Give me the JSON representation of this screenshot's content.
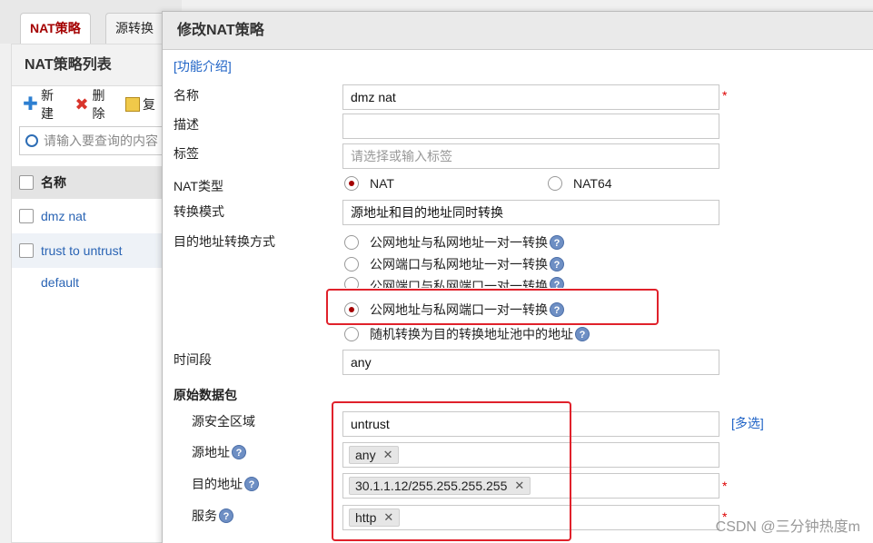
{
  "tabs": [
    {
      "label": "NAT策略",
      "active": true
    },
    {
      "label": "源转换",
      "active": false
    }
  ],
  "left_panel": {
    "title": "NAT策略列表",
    "toolbar": {
      "new_label": "新建",
      "delete_label": "删除",
      "copy_label": "复"
    },
    "search_placeholder": "请输入要查询的内容",
    "column_name": "名称",
    "rows": [
      "dmz  nat",
      "trust to untrust",
      "default"
    ]
  },
  "modal": {
    "title": "修改NAT策略",
    "intro_link": "[功能介绍]",
    "fields": {
      "name_label": "名称",
      "name_value": "dmz  nat",
      "desc_label": "描述",
      "desc_value": "",
      "tag_label": "标签",
      "tag_placeholder": "请选择或输入标签",
      "nat_type_label": "NAT类型",
      "nat_type_options": [
        "NAT",
        "NAT64"
      ],
      "nat_type_selected": "NAT",
      "mode_label": "转换模式",
      "mode_value": "源地址和目的地址同时转换",
      "dst_method_label": "目的地址转换方式",
      "dst_methods": [
        "公网地址与私网地址一对一转换",
        "公网端口与私网地址一对一转换",
        "公网端口与私网端口一对一转换",
        "公网地址与私网端口一对一转换",
        "随机转换为目的转换地址池中的地址"
      ],
      "dst_method_selected_index": 3,
      "time_label": "时间段",
      "time_value": "any"
    },
    "original_packet": {
      "section_title": "原始数据包",
      "src_zone_label": "源安全区域",
      "src_zone_value": "untrust",
      "multi_select_link": "[多选]",
      "src_addr_label": "源地址",
      "src_addr_chips": [
        "any"
      ],
      "dst_addr_label": "目的地址",
      "dst_addr_chips": [
        "30.1.1.12/255.255.255.255"
      ],
      "service_label": "服务",
      "service_chips": [
        "http"
      ]
    },
    "required_mark": "*",
    "help_glyph": "?"
  },
  "watermark": "CSDN @三分钟热度m",
  "colors": {
    "accent_red": "#a40000",
    "highlight_red": "#e0212b",
    "link_blue": "#1f63c6"
  }
}
